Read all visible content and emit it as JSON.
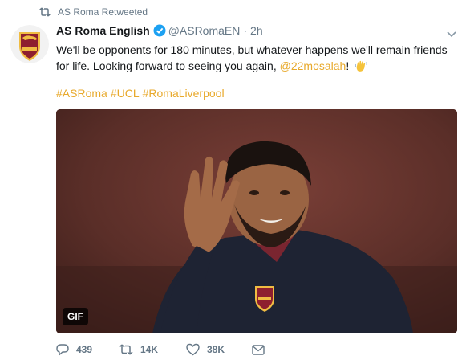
{
  "retweet_context": {
    "text": "AS Roma Retweeted",
    "icon": "retweet-icon"
  },
  "tweet": {
    "display_name": "AS Roma English",
    "handle": "@ASRomaEN",
    "separator": "·",
    "time": "2h",
    "text_part1": "We'll be opponents for 180 minutes, but whatever happens we'll remain friends for life. Looking forward to seeing you again, ",
    "mention": "@22mosalah",
    "text_part2": "!",
    "hashtags": [
      "#ASRoma",
      "#UCL",
      "#RomaLiverpool"
    ],
    "emoji": "waving-hand-icon"
  },
  "media": {
    "badge": "GIF",
    "crest_text": "ROMA",
    "crest_year": "1927"
  },
  "stats": {
    "replies": "439",
    "retweets": "14K",
    "likes": "38K"
  },
  "colors": {
    "accent": "#e8a92b",
    "secondary_text": "#657786",
    "verified": "#1da1f2",
    "roma_red": "#8e1f2f",
    "roma_gold": "#f0bc42"
  }
}
